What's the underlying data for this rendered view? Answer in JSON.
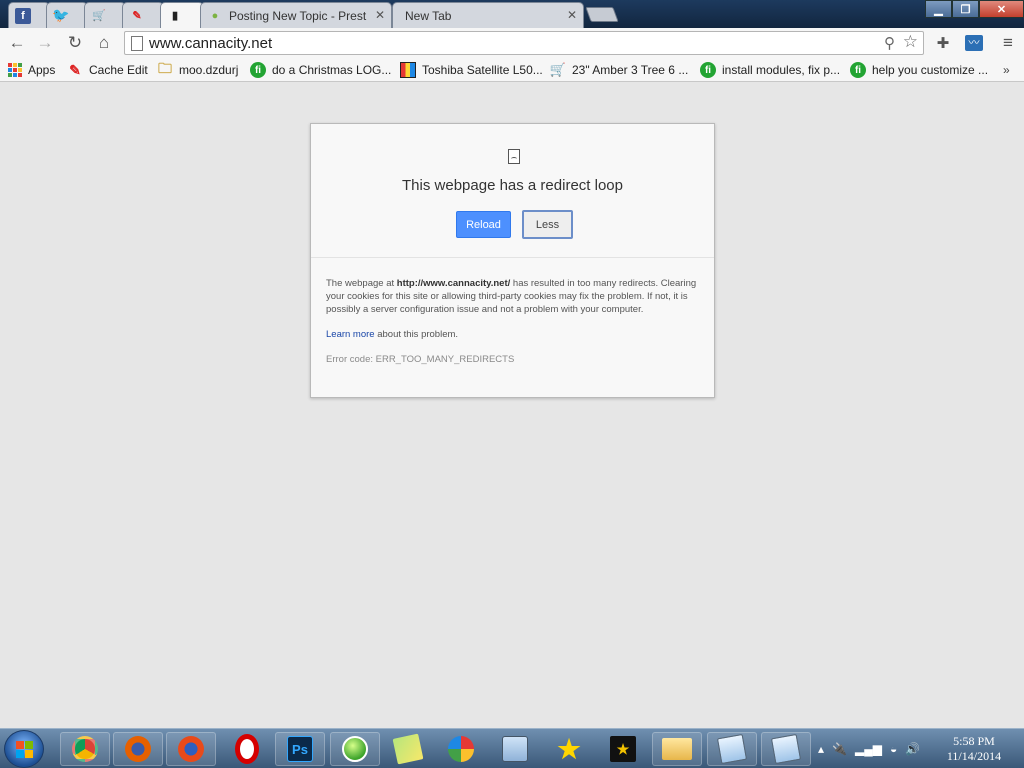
{
  "tabs": [
    {
      "name": "facebook-tab",
      "icon": "facebook-icon",
      "label": ""
    },
    {
      "name": "twitter-tab",
      "icon": "twitter-icon",
      "label": ""
    },
    {
      "name": "cart-tab",
      "icon": "shopping-cart-icon",
      "label": ""
    },
    {
      "name": "cache-edit-tab",
      "icon": "cache-edit-icon",
      "label": ""
    },
    {
      "name": "active-tab",
      "icon": "page-icon",
      "label": ""
    },
    {
      "name": "posting-tab",
      "icon": "prestashop-icon",
      "label": "Posting New Topic - Prest"
    },
    {
      "name": "newtab-tab",
      "icon": "",
      "label": "New Tab"
    }
  ],
  "toolbar": {
    "url": "www.cannacity.net"
  },
  "bookmarks": [
    {
      "label": "Apps",
      "icon": "apps-grid-icon"
    },
    {
      "label": "Cache Edit",
      "icon": "cache-edit-icon"
    },
    {
      "label": "moo.dzdurj",
      "icon": "folder-icon"
    },
    {
      "label": "do a Christmas LOG...",
      "icon": "fiverr-icon"
    },
    {
      "label": "Toshiba Satellite L50...",
      "icon": "toshiba-icon"
    },
    {
      "label": "23\" Amber 3 Tree 6 ...",
      "icon": "shopping-cart-icon"
    },
    {
      "label": "install modules, fix p...",
      "icon": "fiverr-icon"
    },
    {
      "label": "help you customize ...",
      "icon": "fiverr-icon"
    }
  ],
  "error": {
    "title": "This webpage has a redirect loop",
    "reload_label": "Reload",
    "less_label": "Less",
    "details_prefix": "The webpage at ",
    "details_url": "http://www.cannacity.net/",
    "details_suffix": " has resulted in too many redirects. Clearing your cookies for this site or allowing third-party cookies may fix the problem. If not, it is possibly a server configuration issue and not a problem with your computer.",
    "learn_more": "Learn more",
    "learn_more_suffix": " about this problem.",
    "error_code": "Error code: ERR_TOO_MANY_REDIRECTS"
  },
  "taskbar": {
    "apps": [
      "chrome-icon",
      "firefox-icon",
      "firefox-alt-icon",
      "opera-icon",
      "photoshop-icon",
      "green-orb-icon",
      "sticky-notes-icon",
      "picasa-icon",
      "calculator-icon",
      "star-icon",
      "army-icon",
      "file-explorer-icon",
      "notepad-icon",
      "notepad-icon"
    ],
    "photoshop_label": "Ps",
    "time": "5:58 PM",
    "date": "11/14/2014"
  },
  "colors": {
    "accent": "#4d90fe",
    "link": "#1a47a8",
    "fiverr": "#23a433"
  }
}
